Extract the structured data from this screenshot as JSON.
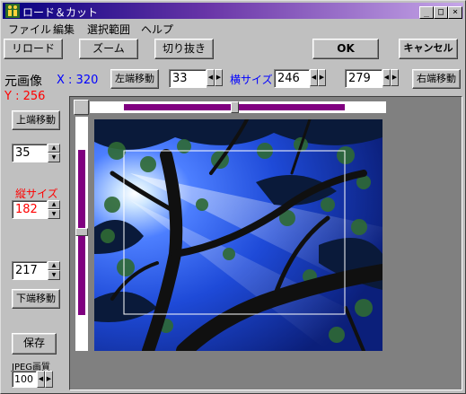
{
  "window": {
    "title": "ロード＆カット"
  },
  "menu": [
    "ファイル",
    "編集",
    "選択範囲",
    "ヘルプ"
  ],
  "toolbar": {
    "reload": "リロード",
    "zoom": "ズーム",
    "cut": "切り抜き",
    "ok": "OK",
    "cancel": "キャンセル"
  },
  "original": {
    "label": "元画像",
    "x": "X : 320",
    "y": "Y : 256"
  },
  "horizontal": {
    "left_move": "左端移動",
    "left_value": "33",
    "size_label": "横サイズ",
    "size_value": "246",
    "right_value": "279",
    "right_move": "右端移動"
  },
  "vertical": {
    "top_move": "上端移動",
    "top_value": "35",
    "size_label": "縦サイズ",
    "size_value": "182",
    "bottom_value": "217",
    "bottom_move": "下端移動"
  },
  "save": {
    "label": "保存",
    "jpeg_label": "JPEG画質",
    "jpeg_value": "100"
  },
  "colors": {
    "accent": "#800080",
    "blue_text": "#0000ff",
    "red_text": "#ff0000",
    "title_start": "#050080"
  }
}
